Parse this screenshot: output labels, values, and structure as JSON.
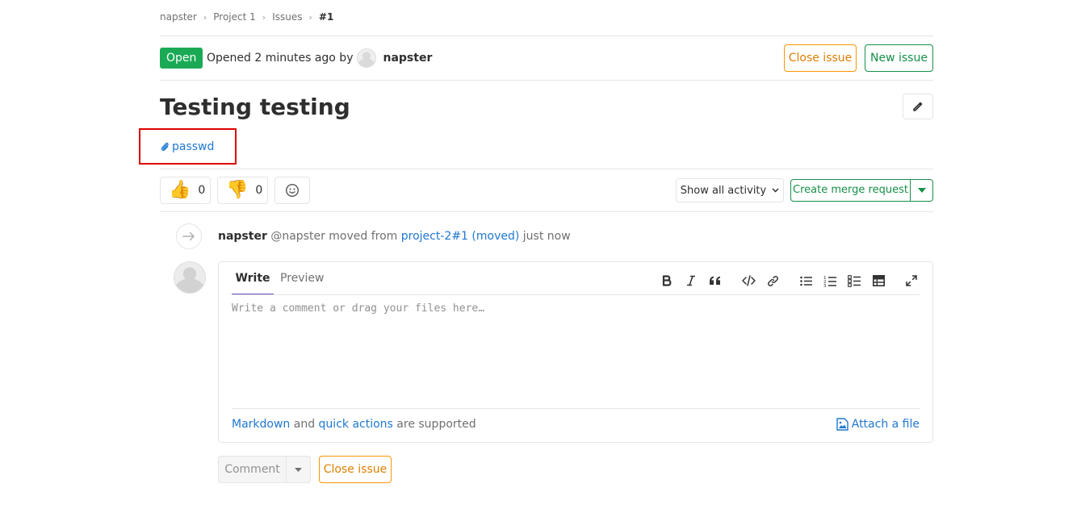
{
  "breadcrumb": {
    "items": [
      "napster",
      "Project 1",
      "Issues"
    ],
    "current": "#1"
  },
  "issue": {
    "status": "Open",
    "opened_text": "Opened 2 minutes ago by",
    "author": "napster",
    "title": "Testing testing",
    "attachment": "passwd"
  },
  "header_actions": {
    "close_issue": "Close issue",
    "new_issue": "New issue"
  },
  "awards": {
    "thumbs_up_count": "0",
    "thumbs_down_count": "0"
  },
  "activity": {
    "filter_label": "Show all activity",
    "create_mr": "Create merge request"
  },
  "timeline": {
    "author": "napster",
    "handle": "@napster",
    "action": "moved from",
    "link": "project-2#1 (moved)",
    "time": "just now"
  },
  "editor": {
    "tab_write": "Write",
    "tab_preview": "Preview",
    "placeholder": "Write a comment or drag your files here…",
    "value": "",
    "markdown_link": "Markdown",
    "and_text": "and",
    "quick_actions_link": "quick actions",
    "supported_text": "are supported",
    "attach_file": "Attach a file"
  },
  "footer_actions": {
    "comment": "Comment",
    "close_issue": "Close issue"
  },
  "colors": {
    "open_badge": "#1aaa55",
    "warning": "#fc9403",
    "success": "#168f48",
    "link": "#1f78d1",
    "active_tab": "#6b4fbb",
    "highlight": "#dd0000"
  },
  "icons": [
    "chevron-right-icon",
    "pencil-icon",
    "paperclip-icon",
    "thumbs-up-icon",
    "thumbs-down-icon",
    "smiley-icon",
    "chevron-down-icon",
    "arrow-right-icon",
    "bold-icon",
    "italic-icon",
    "quote-icon",
    "code-icon",
    "link-icon",
    "bullet-list-icon",
    "numbered-list-icon",
    "task-list-icon",
    "table-icon",
    "fullscreen-icon",
    "image-icon"
  ]
}
